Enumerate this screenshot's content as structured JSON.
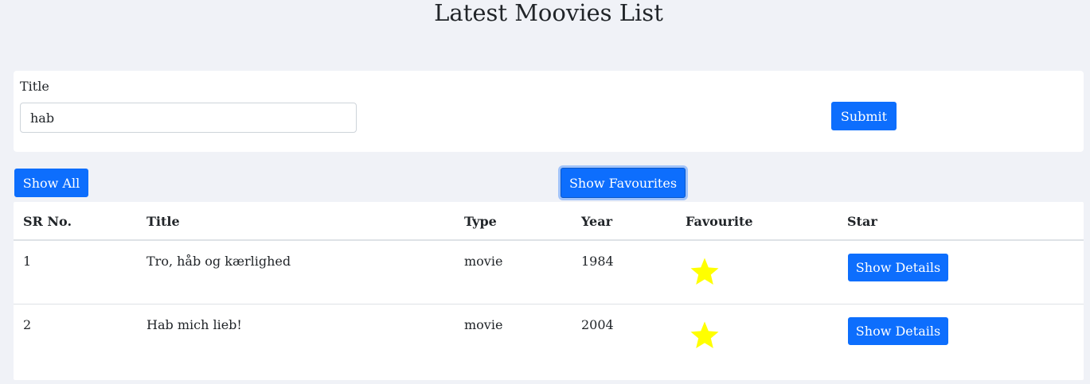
{
  "page": {
    "title": "Latest Moovies List"
  },
  "search": {
    "label": "Title",
    "value": "hab",
    "submit_label": "Submit"
  },
  "actions": {
    "show_all_label": "Show All",
    "show_favourites_label": "Show Favourites"
  },
  "table": {
    "headers": {
      "sr": "SR No.",
      "title": "Title",
      "type": "Type",
      "year": "Year",
      "favourite": "Favourite",
      "star": "Star"
    },
    "rows": [
      {
        "sr": "1",
        "title": "Tro, håb og kærlighed",
        "type": "movie",
        "year": "1984",
        "favourite_icon": "star-icon",
        "details_label": "Show Details"
      },
      {
        "sr": "2",
        "title": "Hab mich lieb!",
        "type": "movie",
        "year": "2004",
        "favourite_icon": "star-icon",
        "details_label": "Show Details"
      }
    ]
  },
  "colors": {
    "accent": "#0d6efd",
    "background": "#f0f2f7",
    "star": "#ffff00"
  }
}
